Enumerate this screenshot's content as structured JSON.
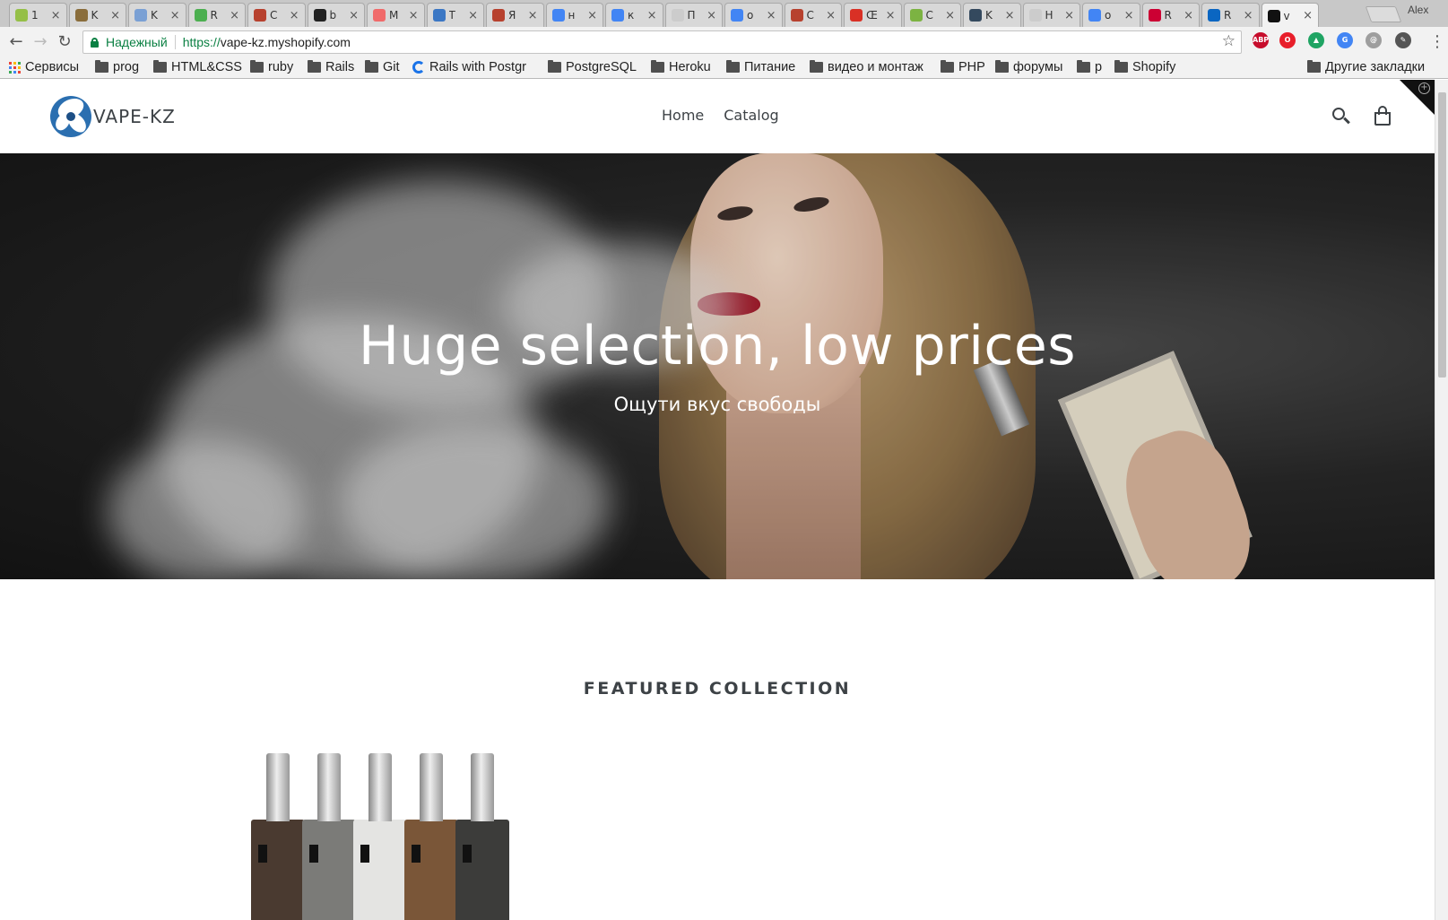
{
  "browser": {
    "tabs": [
      {
        "title": "1",
        "color": "#95bf47"
      },
      {
        "title": "K",
        "color": "#8a6d3b"
      },
      {
        "title": "K",
        "color": "#7aa0d4"
      },
      {
        "title": "R",
        "color": "#4caf50"
      },
      {
        "title": "C",
        "color": "#b7412e"
      },
      {
        "title": "b",
        "color": "#222222"
      },
      {
        "title": "M",
        "color": "#f06a6a"
      },
      {
        "title": "T",
        "color": "#3b77c4"
      },
      {
        "title": "Я",
        "color": "#b7412e"
      },
      {
        "title": "н",
        "color": "#4285f4"
      },
      {
        "title": "к",
        "color": "#4285f4"
      },
      {
        "title": "П",
        "color": "#cccccc"
      },
      {
        "title": "o",
        "color": "#4285f4"
      },
      {
        "title": "C",
        "color": "#b7412e"
      },
      {
        "title": "Œ",
        "color": "#d93025"
      },
      {
        "title": "C",
        "color": "#7cb342"
      },
      {
        "title": "K",
        "color": "#34495e"
      },
      {
        "title": "H",
        "color": "#cccccc"
      },
      {
        "title": "o",
        "color": "#4285f4"
      },
      {
        "title": "R",
        "color": "#cc0033"
      },
      {
        "title": "R",
        "color": "#0a66c2"
      },
      {
        "title": "v",
        "color": "#111111"
      }
    ],
    "active_tab_index": 21,
    "profile_name": "Alex",
    "omnibox": {
      "security_label": "Надежный",
      "url_scheme": "https://",
      "url_host": "vape-kz.myshopify.com"
    },
    "extensions": [
      {
        "name": "adblock-plus-icon",
        "label": "ABP",
        "color": "#c70d2c"
      },
      {
        "name": "opera-icon",
        "label": "O",
        "color": "#e81e2a"
      },
      {
        "name": "google-drive-icon",
        "label": "▲",
        "color": "#1fa463"
      },
      {
        "name": "translate-icon",
        "label": "G",
        "color": "#4285f4"
      },
      {
        "name": "at-icon",
        "label": "@",
        "color": "#9e9e9e"
      },
      {
        "name": "eyedropper-icon",
        "label": "✎",
        "color": "#555555"
      }
    ],
    "bookmarks": [
      {
        "label": "Сервисы",
        "icon": "apps"
      },
      {
        "label": "prog",
        "icon": "folder"
      },
      {
        "label": "HTML&CSS",
        "icon": "folder"
      },
      {
        "label": "ruby",
        "icon": "folder"
      },
      {
        "label": "Rails",
        "icon": "folder"
      },
      {
        "label": "Git",
        "icon": "folder"
      },
      {
        "label": "Rails with Postgr",
        "icon": "sync"
      },
      {
        "label": "PostgreSQL",
        "icon": "folder"
      },
      {
        "label": "Heroku",
        "icon": "folder"
      },
      {
        "label": "Питание",
        "icon": "folder"
      },
      {
        "label": "видео и монтаж",
        "icon": "folder"
      },
      {
        "label": "PHP",
        "icon": "folder"
      },
      {
        "label": "форумы",
        "icon": "folder"
      },
      {
        "label": "p",
        "icon": "folder"
      },
      {
        "label": "Shopify",
        "icon": "folder"
      }
    ],
    "other_bookmarks": "Другие закладки"
  },
  "store": {
    "logo_text": "VAPE-KZ",
    "nav": [
      {
        "label": "Home"
      },
      {
        "label": "Catalog"
      }
    ],
    "hero": {
      "title": "Huge selection, low prices",
      "subtitle": "Ощути вкус свободы"
    },
    "featured": {
      "heading": "FEATURED COLLECTION",
      "product_colors": [
        "#4a3a30",
        "#7b7b78",
        "#e4e4e2",
        "#7a5638",
        "#3c3c3a"
      ]
    }
  }
}
